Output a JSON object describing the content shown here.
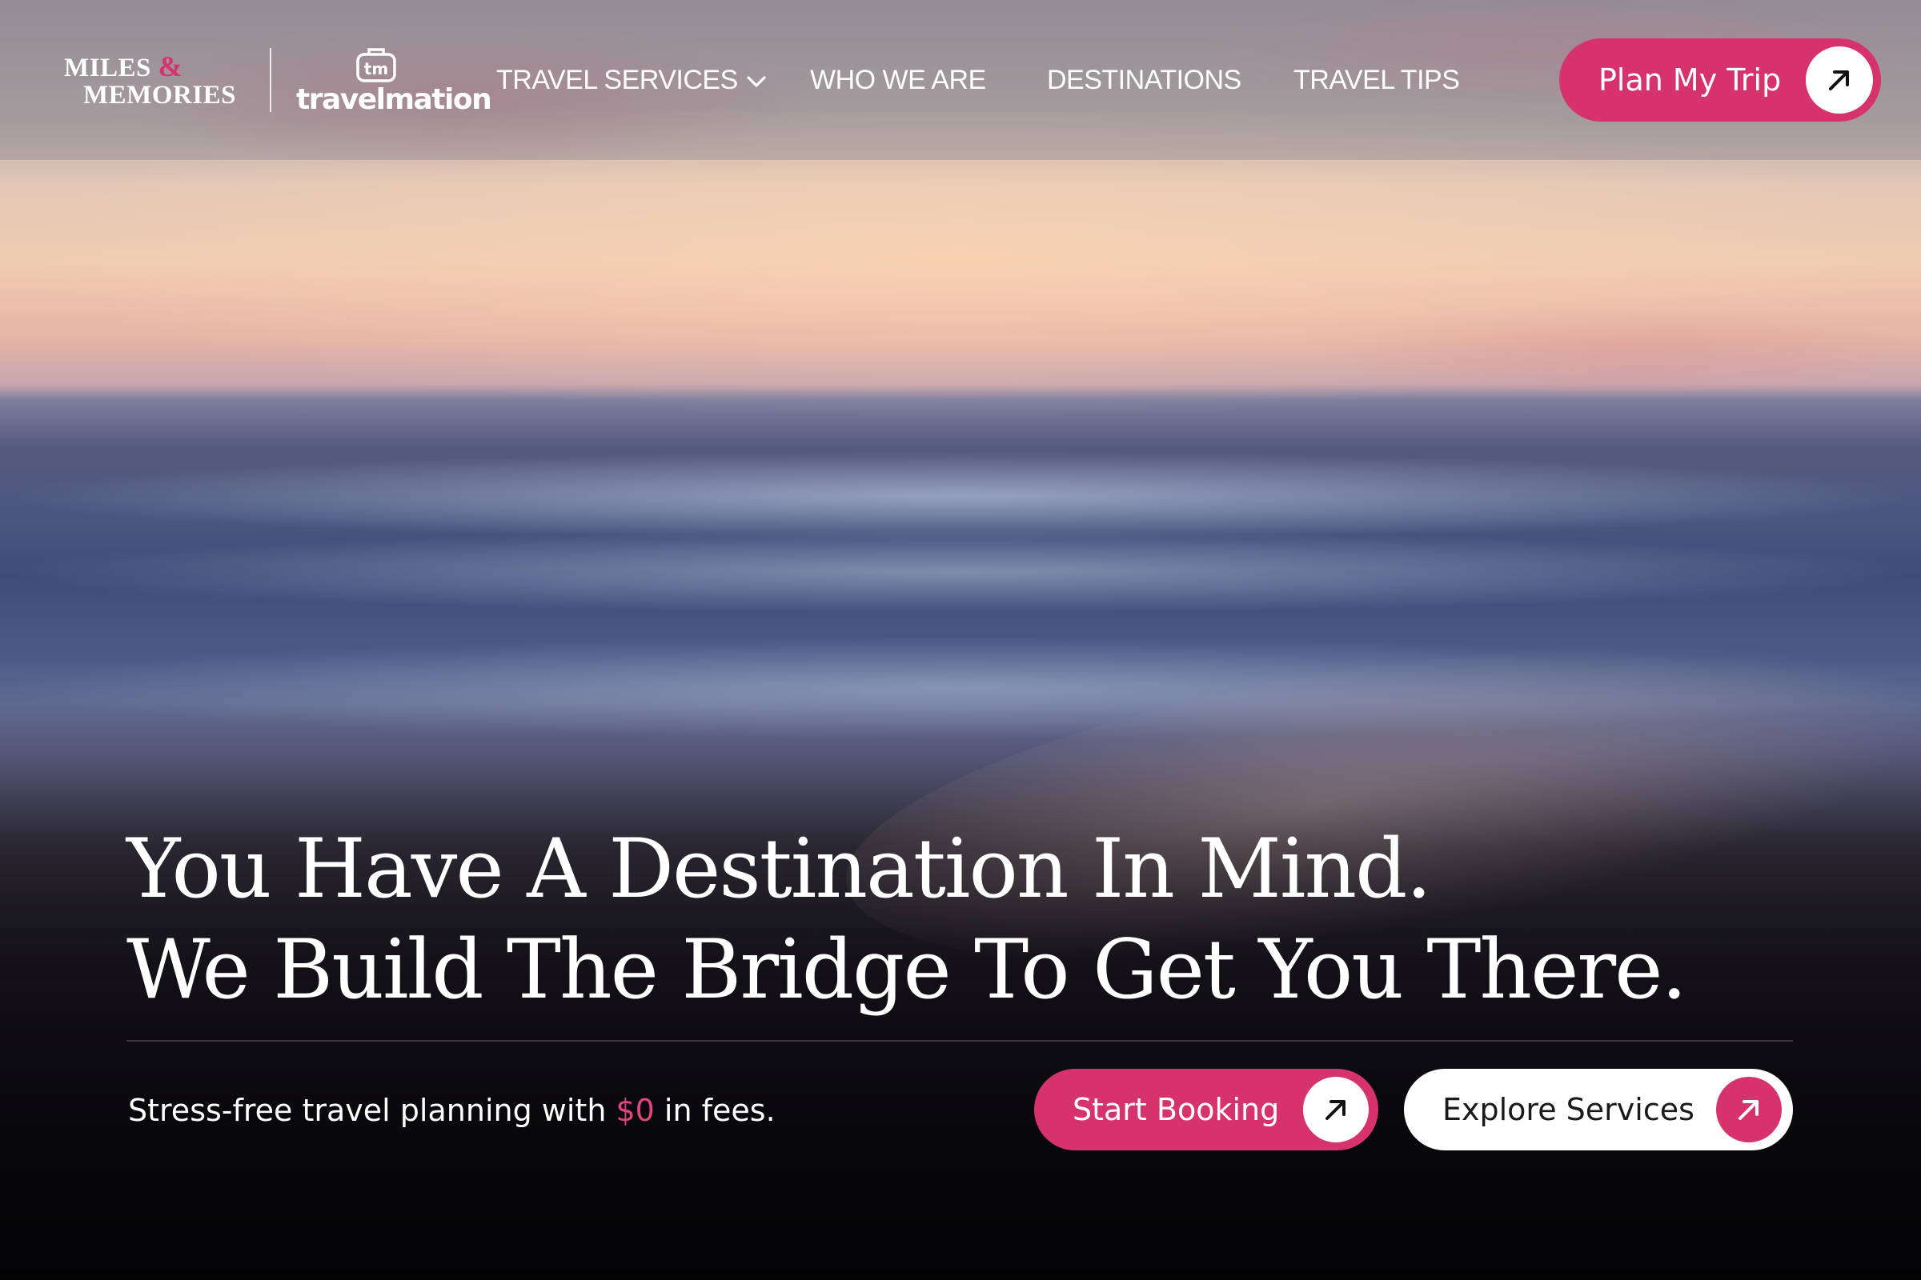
{
  "brand": {
    "primary_logo": {
      "word1": "MILES",
      "amp": "&",
      "word2": "MEMORIES"
    },
    "partner_logo": {
      "icon": "tm-suitcase-icon",
      "icon_text": "tm",
      "wordmark": "travelmation"
    }
  },
  "nav": {
    "items": [
      {
        "label": "TRAVEL SERVICES",
        "has_dropdown": true,
        "icon": "chevron-down-icon"
      },
      {
        "label": "WHO WE ARE"
      },
      {
        "label": "DESTINATIONS"
      },
      {
        "label": "TRAVEL TIPS"
      }
    ],
    "cta": {
      "label": "Plan My Trip",
      "icon": "arrow-up-right-icon"
    }
  },
  "hero": {
    "headline_line1": "You Have A Destination In Mind.",
    "headline_line2": "We Build The Bridge To Get You There.",
    "tagline_before": "Stress-free travel planning with ",
    "tagline_highlight": "$0",
    "tagline_after": " in fees.",
    "primary_button": {
      "label": "Start Booking",
      "icon": "arrow-up-right-icon"
    },
    "secondary_button": {
      "label": "Explore Services",
      "icon": "arrow-up-right-icon"
    }
  },
  "colors": {
    "accent": "#d6336c",
    "white": "#ffffff",
    "header_overlay": "rgba(140,135,145,0.42)"
  }
}
